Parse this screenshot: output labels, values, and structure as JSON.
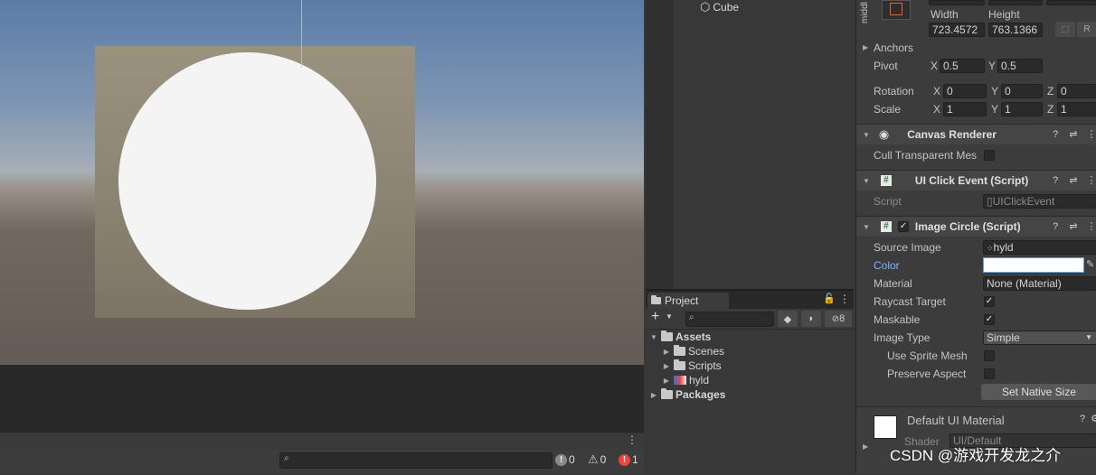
{
  "hierarchy": {
    "item_label": "Cube"
  },
  "project": {
    "tab_label": "Project",
    "hidden_count": "8",
    "tree": [
      {
        "label": "Assets",
        "bold": true
      },
      {
        "label": "Scenes"
      },
      {
        "label": "Scripts"
      },
      {
        "label": "hyld"
      },
      {
        "label": "Packages",
        "bold": true
      }
    ]
  },
  "console": {
    "info_count": "0",
    "warn_count": "0",
    "error_count": "1"
  },
  "inspector": {
    "anchor_preset_label": "middl",
    "width_label": "Width",
    "height_label": "Height",
    "width_value": "723.4572",
    "height_value": "763.1366",
    "raw_button": "R",
    "anchors_label": "Anchors",
    "pivot_label": "Pivot",
    "pivot_x": "0.5",
    "pivot_y": "0.5",
    "rotation_label": "Rotation",
    "rot_x": "0",
    "rot_y": "0",
    "rot_z": "0",
    "scale_label": "Scale",
    "scale_x": "1",
    "scale_y": "1",
    "scale_z": "1",
    "axis_x": "X",
    "axis_y": "Y",
    "axis_z": "Z",
    "canvas_renderer": {
      "title": "Canvas Renderer",
      "cull_label": "Cull Transparent Mes"
    },
    "ui_click": {
      "title": "UI Click Event (Script)",
      "script_label": "Script",
      "script_value": "UIClickEvent"
    },
    "image_circle": {
      "title": "Image Circle (Script)",
      "source_image_label": "Source Image",
      "source_image_value": "hyld",
      "color_label": "Color",
      "material_label": "Material",
      "material_value": "None (Material)",
      "raycast_label": "Raycast Target",
      "maskable_label": "Maskable",
      "image_type_label": "Image Type",
      "image_type_value": "Simple",
      "sprite_mesh_label": "Use Sprite Mesh",
      "preserve_label": "Preserve Aspect",
      "native_size_button": "Set Native Size"
    },
    "default_material": {
      "title": "Default UI Material",
      "shader_label": "Shader",
      "shader_value": "UI/Default"
    }
  },
  "watermark": "CSDN @游戏开发龙之介",
  "colors": {
    "circle": "#f4f4f4",
    "accent_link": "#7ab4ff",
    "error": "#e8453c"
  }
}
